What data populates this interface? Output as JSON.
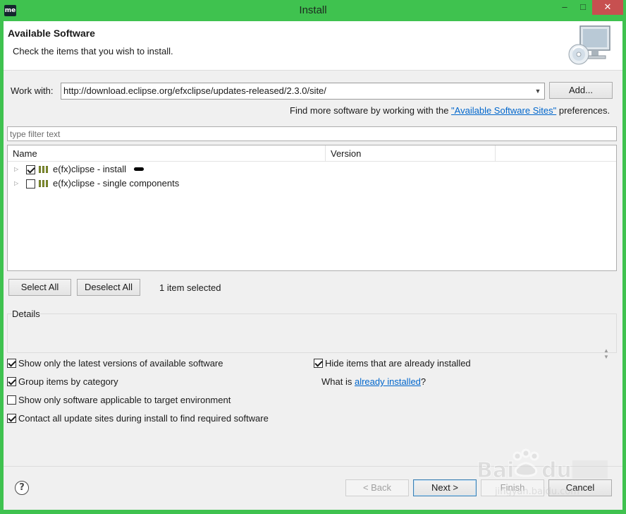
{
  "window": {
    "app_icon_text": "me",
    "title": "Install",
    "minimize_glyph": "‒",
    "maximize_glyph": "□",
    "close_glyph": "✕"
  },
  "banner": {
    "title": "Available Software",
    "subtitle": "Check the items that you wish to install.",
    "icon": "monitor-with-cd-icon"
  },
  "work_with": {
    "label": "Work with:",
    "value": "http://download.eclipse.org/efxclipse/updates-released/2.3.0/site/",
    "add_button": "Add...",
    "find_more_prefix": "Find more software by working with the ",
    "find_more_link": "\"Available Software Sites\"",
    "find_more_suffix": " preferences."
  },
  "filter": {
    "placeholder": "type filter text"
  },
  "tree": {
    "columns": [
      "Name",
      "Version"
    ],
    "rows": [
      {
        "label": "e(fx)clipse - install",
        "checked": true,
        "version": ""
      },
      {
        "label": "e(fx)clipse - single components",
        "checked": false,
        "version": ""
      }
    ]
  },
  "selection": {
    "select_all": "Select All",
    "deselect_all": "Deselect All",
    "status": "1 item selected"
  },
  "details": {
    "label": "Details"
  },
  "options": {
    "latest_versions": {
      "label": "Show only the latest versions of available software",
      "checked": true
    },
    "group_by_category": {
      "label": "Group items by category",
      "checked": true
    },
    "target_env": {
      "label": "Show only software applicable to target environment",
      "checked": false
    },
    "contact_sites": {
      "label": "Contact all update sites during install to find required software",
      "checked": true
    },
    "hide_installed": {
      "label": "Hide items that are already installed",
      "checked": true
    },
    "what_is_prefix": "What is ",
    "what_is_link": "already installed",
    "what_is_suffix": "?"
  },
  "footer": {
    "help": "?",
    "back": "< Back",
    "next": "Next >",
    "finish": "Finish",
    "cancel": "Cancel"
  },
  "colors": {
    "frame": "#3fc24f",
    "close": "#c75050",
    "link": "#0066cc",
    "dialog_bg": "#f0f0f0"
  }
}
